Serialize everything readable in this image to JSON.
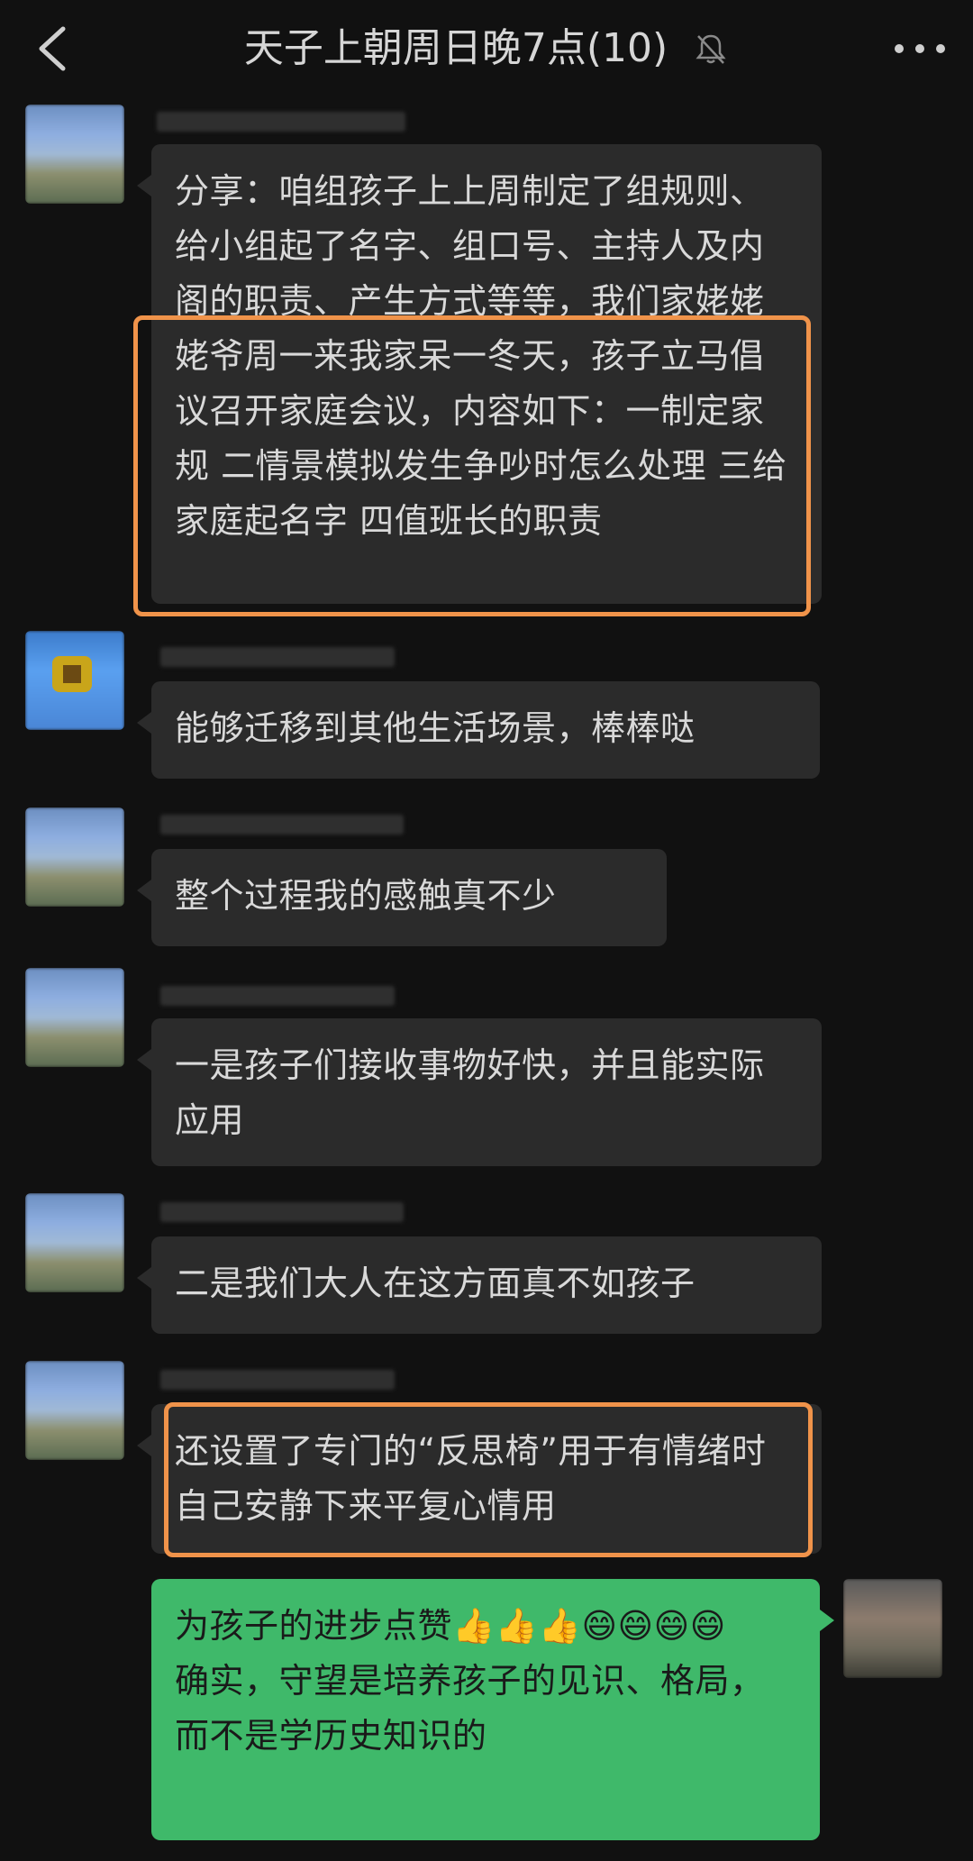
{
  "header": {
    "title": "天子上朝周日晚7点(10)",
    "back_icon": "chevron-left-icon",
    "mute_icon": "bell-muted-icon",
    "more_icon": "more-dots-icon"
  },
  "messages": [
    {
      "text": "分享：咱组孩子上上周制定了组规则、给小组起了名字、组口号、主持人及内阁的职责、产生方式等等，我们家姥姥姥爷周一来我家呆一冬天，孩子立马倡议召开家庭会议，内容如下：一制定家规 二情景模拟发生争吵时怎么处理 三给家庭起名字 四值班长的职责"
    },
    {
      "text": "能够迁移到其他生活场景，棒棒哒"
    },
    {
      "text": "整个过程我的感触真不少"
    },
    {
      "text": "一是孩子们接收事物好快，并且能实际应用"
    },
    {
      "text": "二是我们大人在这方面真不如孩子"
    },
    {
      "text": "还设置了专门的“反思椅”用于有情绪时自己安静下来平复心情用"
    }
  ],
  "my_message": {
    "line1": "为孩子的进步点赞👍👍👍😄😄😄😄",
    "line2": "确实，守望是培养孩子的见识、格局，而不是学历史知识的"
  },
  "colors": {
    "background": "#111111",
    "bubble_other": "#2b2b2b",
    "bubble_mine": "#3fb96a",
    "highlight": "#f0934a"
  }
}
